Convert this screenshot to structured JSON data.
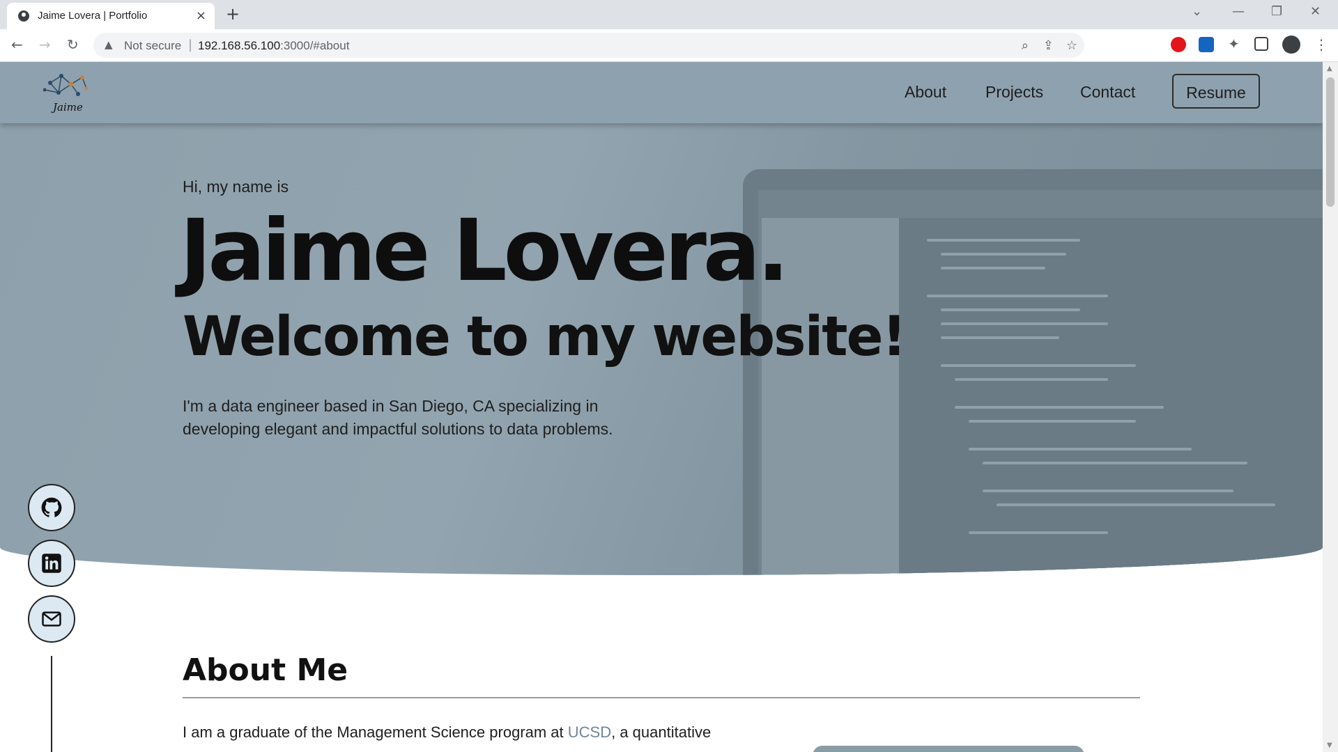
{
  "browser": {
    "tab_title": "Jaime Lovera | Portfolio",
    "security_label": "Not secure",
    "url_host": "192.168.56.100",
    "url_rest": ":3000/#about"
  },
  "nav": {
    "logo_text": "Jaime",
    "links": [
      "About",
      "Projects",
      "Contact"
    ],
    "resume_label": "Resume"
  },
  "hero": {
    "greeting": "Hi, my name is",
    "name": "Jaime Lovera.",
    "welcome": "Welcome to my website!",
    "description": "I'm a data engineer based in San Diego, CA specializing in developing elegant and impactful solutions to data problems."
  },
  "social": [
    "github-icon",
    "linkedin-icon",
    "mail-icon"
  ],
  "about": {
    "title": "About Me",
    "text_before": "I am a graduate of the Management Science program at ",
    "link_text": "UCSD",
    "text_after": ", a quantitative"
  },
  "colors": {
    "hero_bg": "#8ea1ae",
    "link": "#6f8796",
    "social_bg": "#dce9f2"
  }
}
